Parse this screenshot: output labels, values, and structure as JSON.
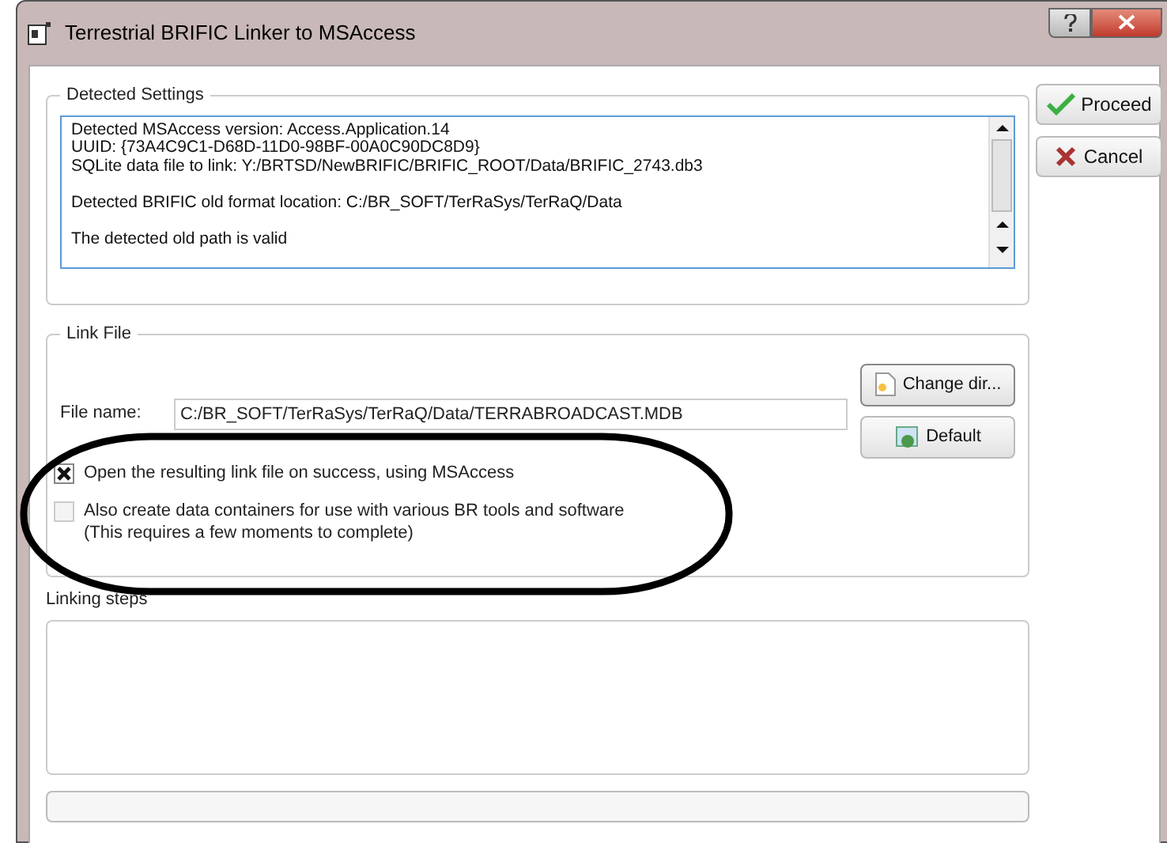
{
  "window": {
    "title": "Terrestrial BRIFIC Linker to MSAccess"
  },
  "detected_settings": {
    "title": "Detected Settings",
    "log_paragraphs": [
      [
        "Detected MSAccess version: Access.Application.14",
        "UUID: {73A4C9C1-D68D-11D0-98BF-00A0C90DC8D9}",
        "SQLite data file to link: Y:/BRTSD/NewBRIFIC/BRIFIC_ROOT/Data/BRIFIC_2743.db3"
      ],
      [
        "Detected BRIFIC old format location: C:/BR_SOFT/TerRaSys/TerRaQ/Data"
      ],
      [
        "The detected old path is valid"
      ]
    ]
  },
  "buttons": [
    {
      "kind": "proceed",
      "label": "Proceed"
    },
    {
      "kind": "cancel",
      "label": "Cancel"
    }
  ],
  "link_file": {
    "title": "Link File",
    "file_label": "File name:",
    "file_value": "C:/BR_SOFT/TerRaSys/TerRaQ/Data/TERRABROADCAST.MDB",
    "change_dir": "Change dir...",
    "default": "Default",
    "options": [
      {
        "label": "Open the resulting link file on success, using MSAccess",
        "checked": true
      },
      {
        "label": "Also create data containers for use with various BR tools and software\n(This requires a few moments to complete)",
        "checked": false
      }
    ]
  },
  "linking_steps": {
    "title": "Linking steps"
  },
  "progress": {
    "level": 0
  }
}
